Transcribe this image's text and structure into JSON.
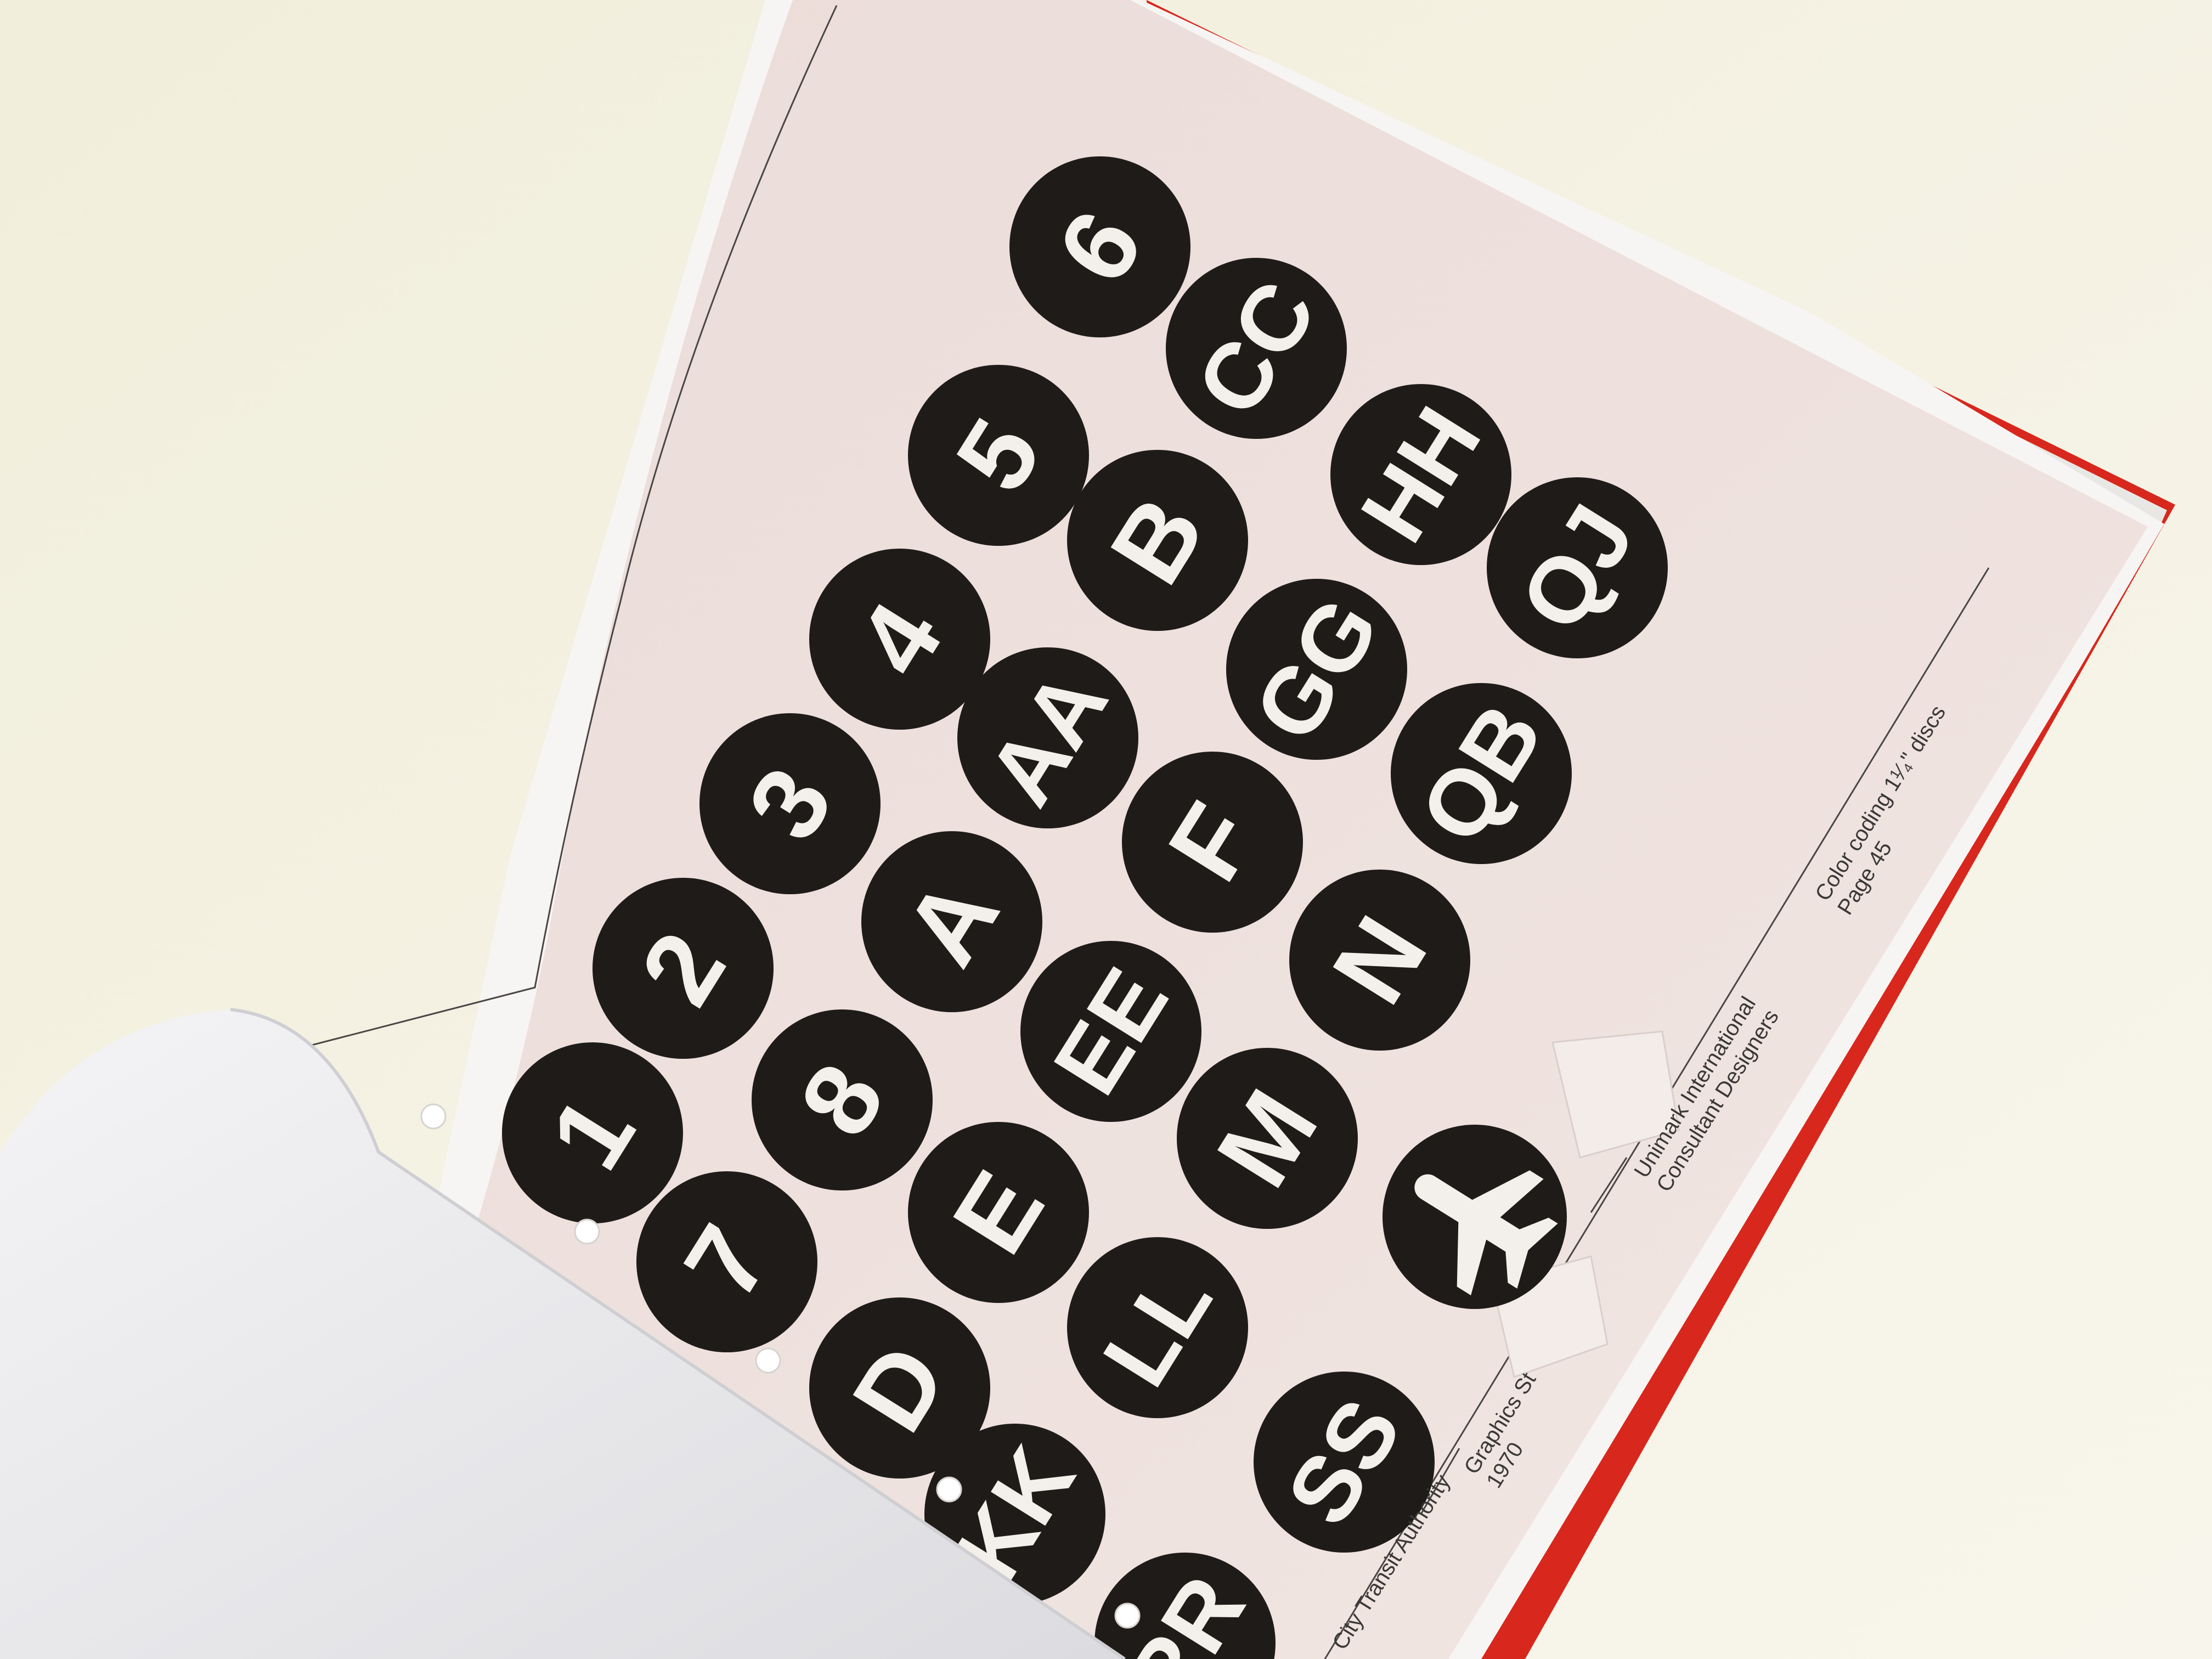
{
  "colors": {
    "background": "#f4f1e3",
    "page": "#efe3e0",
    "disc": "#1f1b19",
    "disc_text": "#f3efea",
    "binder_red": "#d8271c",
    "turned_page": "#ebebee"
  },
  "discs": [
    {
      "label": "1"
    },
    {
      "label": "2"
    },
    {
      "label": "3"
    },
    {
      "label": "4"
    },
    {
      "label": "5"
    },
    {
      "label": "6"
    },
    {
      "label": "7"
    },
    {
      "label": "8"
    },
    {
      "label": "A"
    },
    {
      "label": "AA"
    },
    {
      "label": "B"
    },
    {
      "label": "CC"
    },
    {
      "label": "D"
    },
    {
      "label": "E"
    },
    {
      "label": "EE"
    },
    {
      "label": "F"
    },
    {
      "label": "GG"
    },
    {
      "label": "HH"
    },
    {
      "label": "KK"
    },
    {
      "label": "LL"
    },
    {
      "label": "M"
    },
    {
      "label": "N"
    },
    {
      "label": "QB"
    },
    {
      "label": "QJ"
    },
    {
      "label": "RR"
    },
    {
      "label": "SS"
    },
    {
      "label": "",
      "icon": "airplane-icon"
    }
  ],
  "captions": {
    "client": "City Transit Authority",
    "project_line1": "Graphics St",
    "project_line2": "1970",
    "designer_line1": "Unimark International",
    "designer_line2": "Consultant Designers",
    "subject_line1": "Color coding 1¹⁄₄\" discs",
    "subject_line2": "Page 45"
  }
}
